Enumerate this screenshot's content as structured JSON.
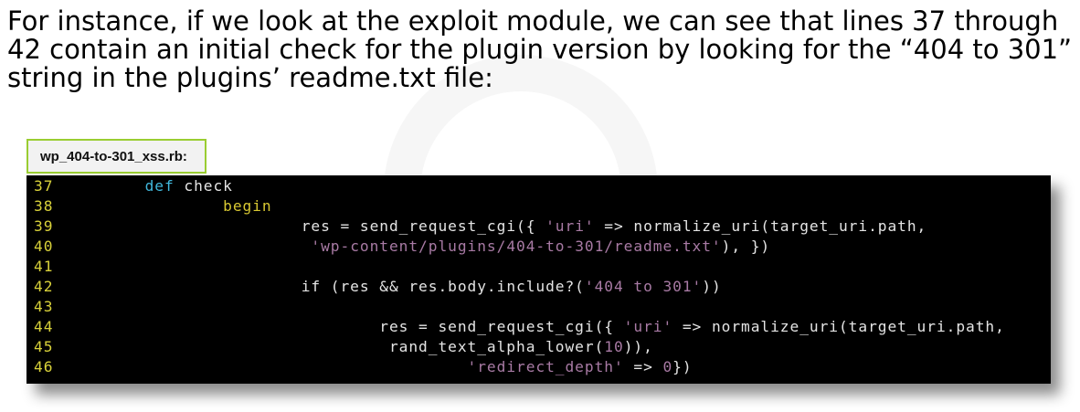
{
  "intro": "For instance, if we look at the exploit module, we can see that lines 37 through 42 contain an initial check for the plugin version by looking for the “404 to 301” string in the plugins’ readme.txt file:",
  "file_label": "wp_404-to-301_xss.rb:",
  "colors": {
    "keyword": "#41b8dc",
    "begin": "#d8c832",
    "string": "#a87aa4",
    "line_number": "#d9d23a",
    "label_border": "#9acd32"
  },
  "code_lines": [
    {
      "n": "37",
      "segs": [
        [
          "\t",
          ""
        ],
        [
          "def",
          "kw"
        ],
        [
          " check",
          ""
        ]
      ]
    },
    {
      "n": "38",
      "segs": [
        [
          "\t\t",
          ""
        ],
        [
          "begin",
          "kw2"
        ]
      ]
    },
    {
      "n": "39",
      "segs": [
        [
          "\t\t\tres = send_request_cgi({ ",
          ""
        ],
        [
          "'uri'",
          "str"
        ],
        [
          " => normalize_uri(target_uri.path,",
          ""
        ]
      ]
    },
    {
      "n": "40",
      "segs": [
        [
          "\t\t\t ",
          ""
        ],
        [
          "'wp-content/plugins/404-to-301/readme.txt'",
          "str"
        ],
        [
          "), })",
          ""
        ]
      ]
    },
    {
      "n": "41",
      "segs": []
    },
    {
      "n": "42",
      "segs": [
        [
          "\t\t\tif (res && res.body.include?(",
          ""
        ],
        [
          "'404 to 301'",
          "str"
        ],
        [
          "))",
          ""
        ]
      ]
    },
    {
      "n": "43",
      "segs": []
    },
    {
      "n": "44",
      "segs": [
        [
          "\t\t\t\tres = send_request_cgi({ ",
          ""
        ],
        [
          "'uri'",
          "str"
        ],
        [
          " => normalize_uri(target_uri.path,",
          ""
        ]
      ]
    },
    {
      "n": "45",
      "segs": [
        [
          "\t\t\t\t rand_text_alpha_lower(",
          ""
        ],
        [
          "10",
          "num"
        ],
        [
          ")),",
          ""
        ]
      ]
    },
    {
      "n": "46",
      "segs": [
        [
          "\t\t\t\t\t ",
          ""
        ],
        [
          "'redirect_depth'",
          "str"
        ],
        [
          " => ",
          ""
        ],
        [
          "0",
          "num"
        ],
        [
          "})",
          ""
        ]
      ]
    }
  ]
}
